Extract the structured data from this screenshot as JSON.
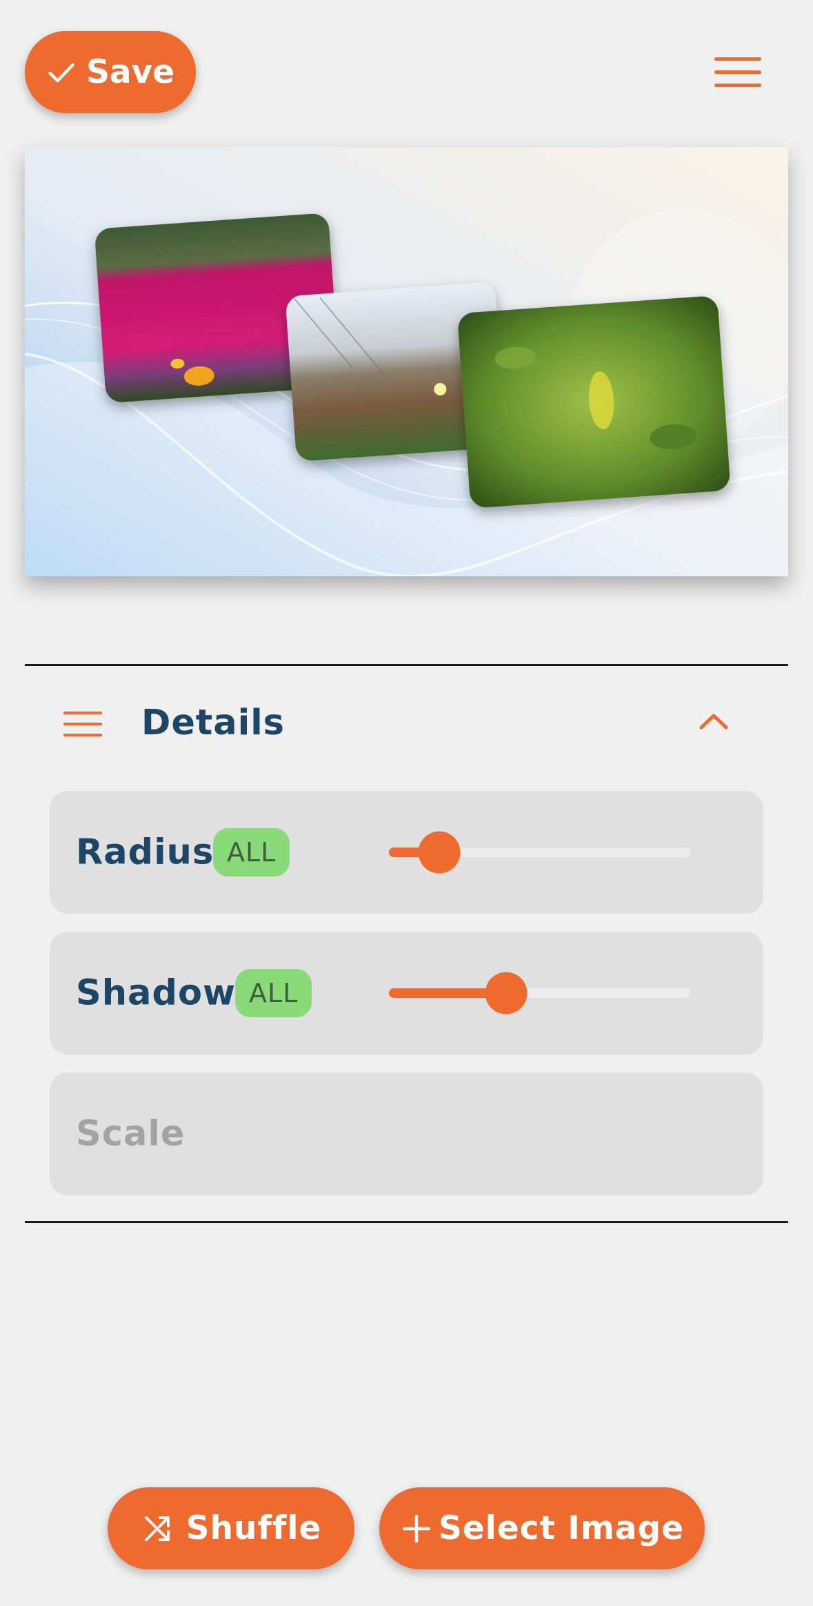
{
  "toolbar": {
    "save_label": "Save",
    "save_icon": "check-icon",
    "menu_icon": "hamburger-menu-icon"
  },
  "preview": {
    "photos": [
      "flower-photo",
      "dune-grass-photo",
      "green-leaves-photo"
    ]
  },
  "details": {
    "title": "Details",
    "menu_icon": "hamburger-menu-icon",
    "collapse_icon": "chevron-up-icon",
    "settings": [
      {
        "label": "Radius",
        "badge": "ALL",
        "value": 0.17,
        "enabled": true
      },
      {
        "label": "Shadow",
        "badge": "ALL",
        "value": 0.39,
        "enabled": true
      },
      {
        "label": "Scale",
        "enabled": false
      }
    ]
  },
  "actions": {
    "shuffle_label": "Shuffle",
    "shuffle_icon": "shuffle-icon",
    "select_label": "Select Image",
    "select_icon": "plus-icon"
  },
  "colors": {
    "accent": "#ee6a2f",
    "title": "#1d4566",
    "badge": "#8bda7a",
    "background": "#f0f0f0",
    "card": "#e0e0e0"
  }
}
